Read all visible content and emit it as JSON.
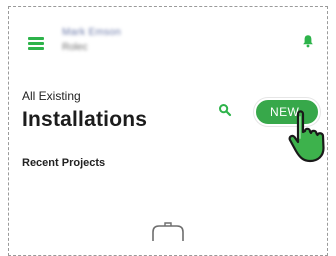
{
  "header": {
    "menu_icon": "menu-icon",
    "user_name": "Mark Emson",
    "user_org": "Rolec",
    "notification_icon": "bell-icon"
  },
  "page": {
    "subtitle": "All Existing",
    "title": "Installations",
    "search_icon": "search-icon",
    "new_label": "NEW",
    "section_label": "Recent Projects"
  },
  "colors": {
    "accent": "#2db34a",
    "button": "#37a84a",
    "text": "#1c1c1c"
  }
}
